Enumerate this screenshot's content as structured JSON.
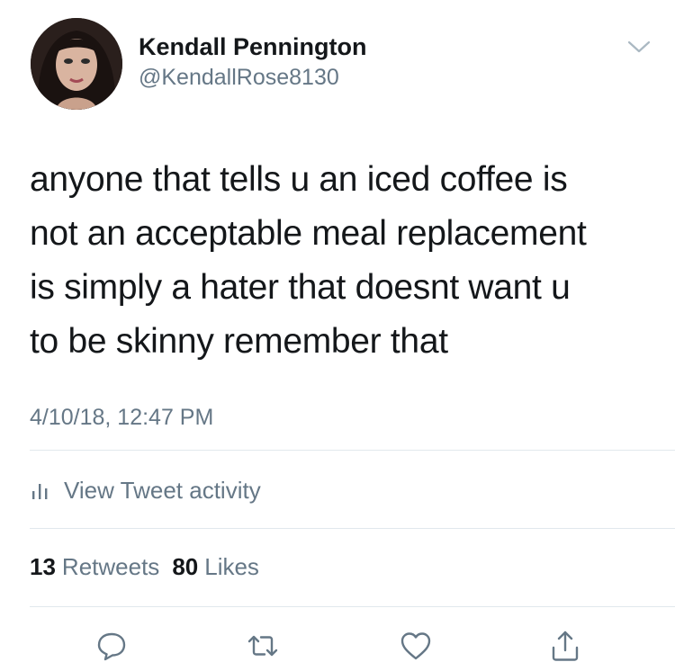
{
  "user": {
    "display_name": "Kendall Pennington",
    "handle": "@KendallRose8130"
  },
  "tweet": {
    "text_lines": [
      "anyone that tells u an iced coffee is",
      "not an acceptable meal replacement",
      "is simply a hater that doesnt want u",
      "to be skinny remember that"
    ],
    "timestamp": "4/10/18, 12:47 PM"
  },
  "activity": {
    "label": "View Tweet activity",
    "icon": "bar-chart-icon"
  },
  "stats": {
    "retweets_count": "13",
    "retweets_label": "Retweets",
    "likes_count": "80",
    "likes_label": "Likes"
  },
  "actions": {
    "icons": [
      "reply-icon",
      "retweet-icon",
      "like-icon",
      "share-icon"
    ]
  },
  "colors": {
    "primary_text": "#14171a",
    "secondary_text": "#657786",
    "divider": "#e1e8ed",
    "icon": "#657786"
  }
}
